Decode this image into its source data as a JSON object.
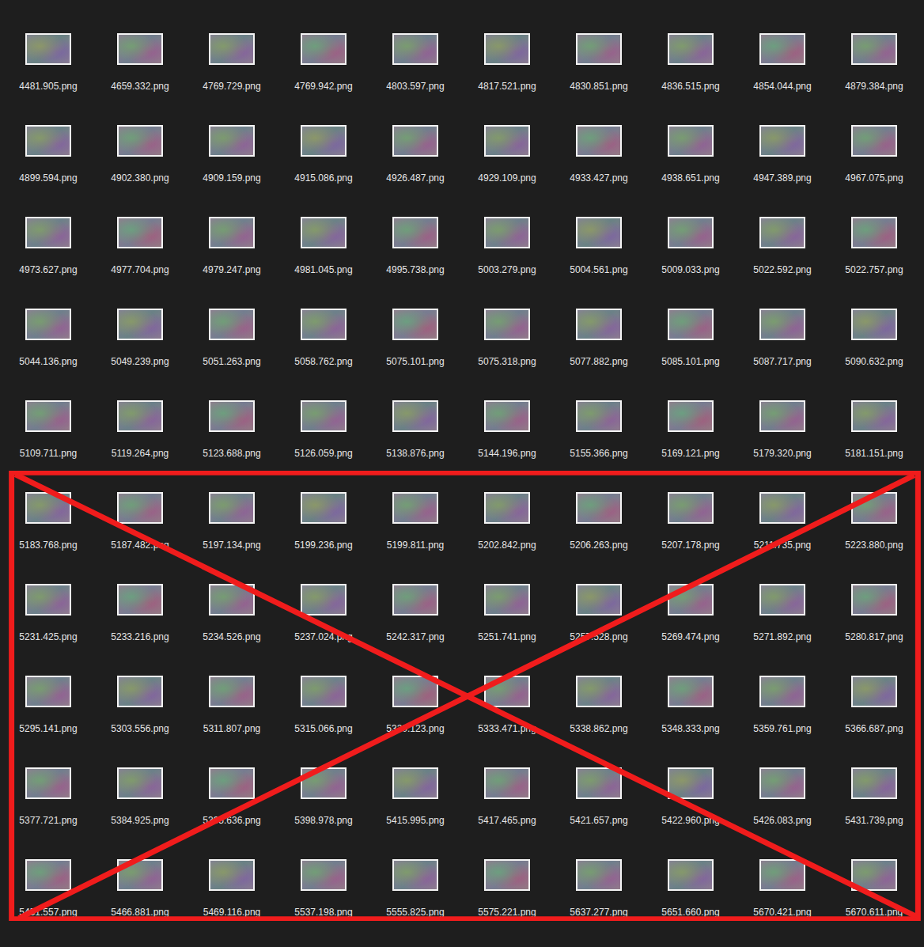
{
  "groups": [
    {
      "crossed_out": false,
      "files": [
        "4481.905.png",
        "4659.332.png",
        "4769.729.png",
        "4769.942.png",
        "4803.597.png",
        "4817.521.png",
        "4830.851.png",
        "4836.515.png",
        "4854.044.png",
        "4879.384.png",
        "4899.594.png",
        "4902.380.png",
        "4909.159.png",
        "4915.086.png",
        "4926.487.png",
        "4929.109.png",
        "4933.427.png",
        "4938.651.png",
        "4947.389.png",
        "4967.075.png",
        "4973.627.png",
        "4977.704.png",
        "4979.247.png",
        "4981.045.png",
        "4995.738.png",
        "5003.279.png",
        "5004.561.png",
        "5009.033.png",
        "5022.592.png",
        "5022.757.png",
        "5044.136.png",
        "5049.239.png",
        "5051.263.png",
        "5058.762.png",
        "5075.101.png",
        "5075.318.png",
        "5077.882.png",
        "5085.101.png",
        "5087.717.png",
        "5090.632.png",
        "5109.711.png",
        "5119.264.png",
        "5123.688.png",
        "5126.059.png",
        "5138.876.png",
        "5144.196.png",
        "5155.366.png",
        "5169.121.png",
        "5179.320.png",
        "5181.151.png"
      ]
    },
    {
      "crossed_out": true,
      "files": [
        "5183.768.png",
        "5187.482.png",
        "5197.134.png",
        "5199.236.png",
        "5199.811.png",
        "5202.842.png",
        "5206.263.png",
        "5207.178.png",
        "5211.735.png",
        "5223.880.png",
        "5231.425.png",
        "5233.216.png",
        "5234.526.png",
        "5237.024.png",
        "5242.317.png",
        "5251.741.png",
        "5257.528.png",
        "5269.474.png",
        "5271.892.png",
        "5280.817.png",
        "5295.141.png",
        "5303.556.png",
        "5311.807.png",
        "5315.066.png",
        "5320.123.png",
        "5333.471.png",
        "5338.862.png",
        "5348.333.png",
        "5359.761.png",
        "5366.687.png",
        "5377.721.png",
        "5384.925.png",
        "5395.636.png",
        "5398.978.png",
        "5415.995.png",
        "5417.465.png",
        "5421.657.png",
        "5422.960.png",
        "5426.083.png",
        "5431.739.png",
        "5451.557.png",
        "5466.881.png",
        "5469.116.png",
        "5537.198.png",
        "5555.825.png",
        "5575.221.png",
        "5637.277.png",
        "5651.660.png",
        "5670.421.png",
        "5670.611.png"
      ]
    }
  ]
}
